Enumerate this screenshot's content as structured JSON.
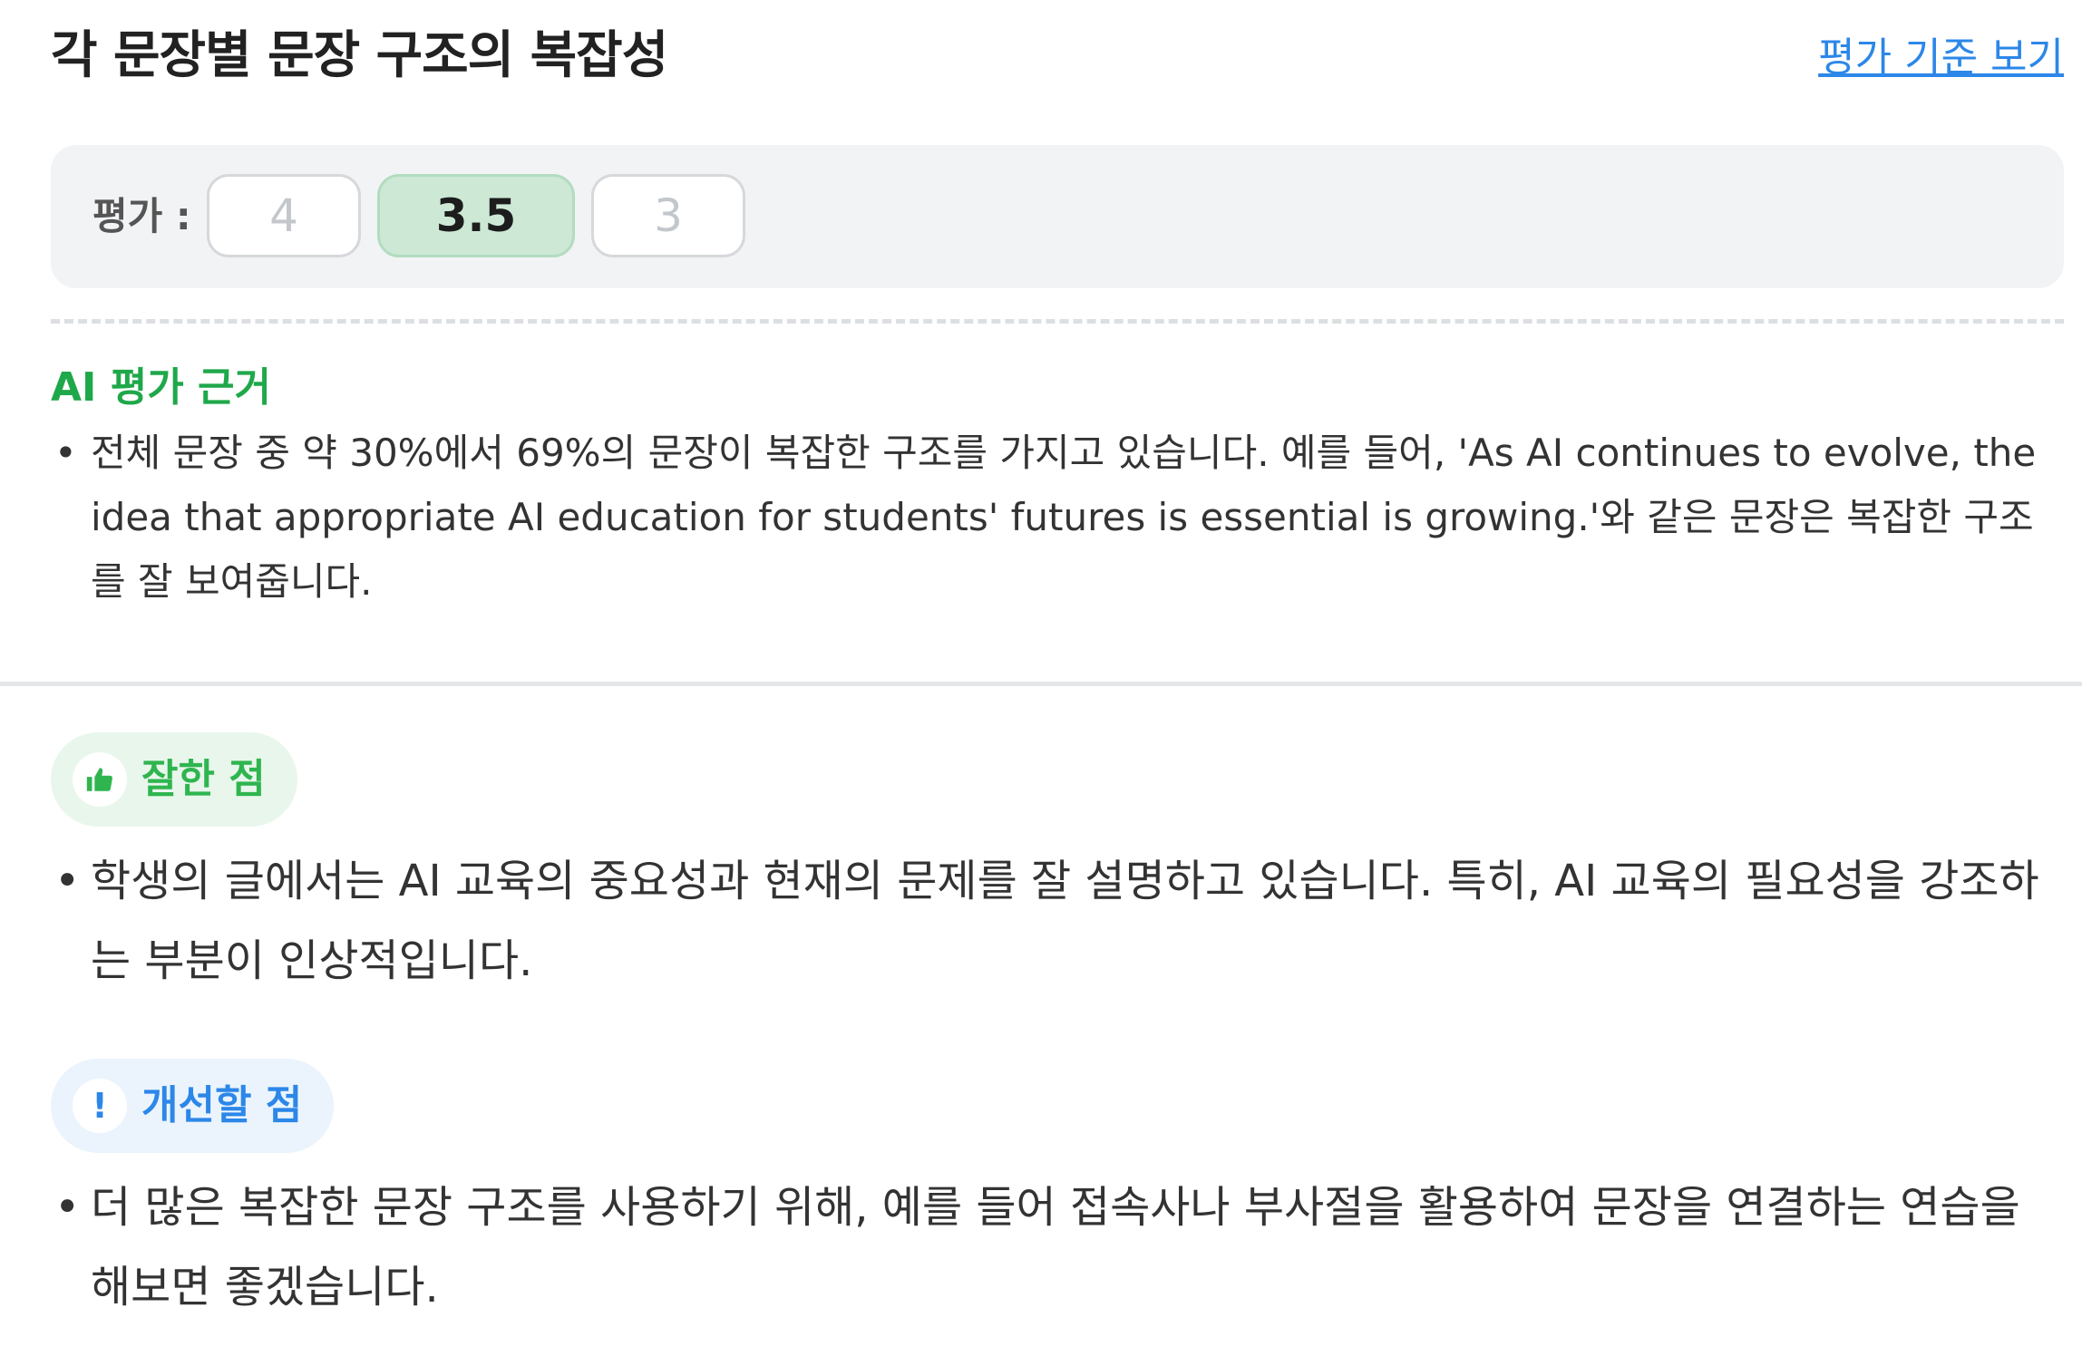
{
  "header": {
    "title": "각 문장별 문장 구조의 복잡성",
    "criteria_link": "평가 기준 보기"
  },
  "rating": {
    "label": "평가 :",
    "options": [
      "4",
      "3.5",
      "3"
    ],
    "selected": "3.5"
  },
  "ai_basis": {
    "heading": "AI 평가 근거",
    "items": [
      "전체 문장 중 약 30%에서 69%의 문장이 복잡한 구조를 가지고 있습니다. 예를 들어, 'As AI continues to evolve, the idea that appropriate AI education for students' futures is essential is growing.'와 같은 문장은 복잡한 구조를 잘 보여줍니다."
    ]
  },
  "strengths": {
    "label": "잘한 점",
    "icon": "thumbs-up-icon",
    "items": [
      "학생의 글에서는 AI 교육의 중요성과 현재의 문제를 잘 설명하고 있습니다. 특히, AI 교육의 필요성을 강조하는 부분이 인상적입니다."
    ]
  },
  "improvements": {
    "label": "개선할 점",
    "icon": "exclamation-icon",
    "items": [
      "더 많은 복잡한 문장 구조를 사용하기 위해, 예를 들어 접속사나 부사절을 활용하여 문장을 연결하는 연습을 해보면 좋겠습니다."
    ]
  },
  "colors": {
    "accent_green": "#1fa84a",
    "accent_blue": "#2c87e8",
    "selected_chip_bg": "#cde9d6"
  }
}
